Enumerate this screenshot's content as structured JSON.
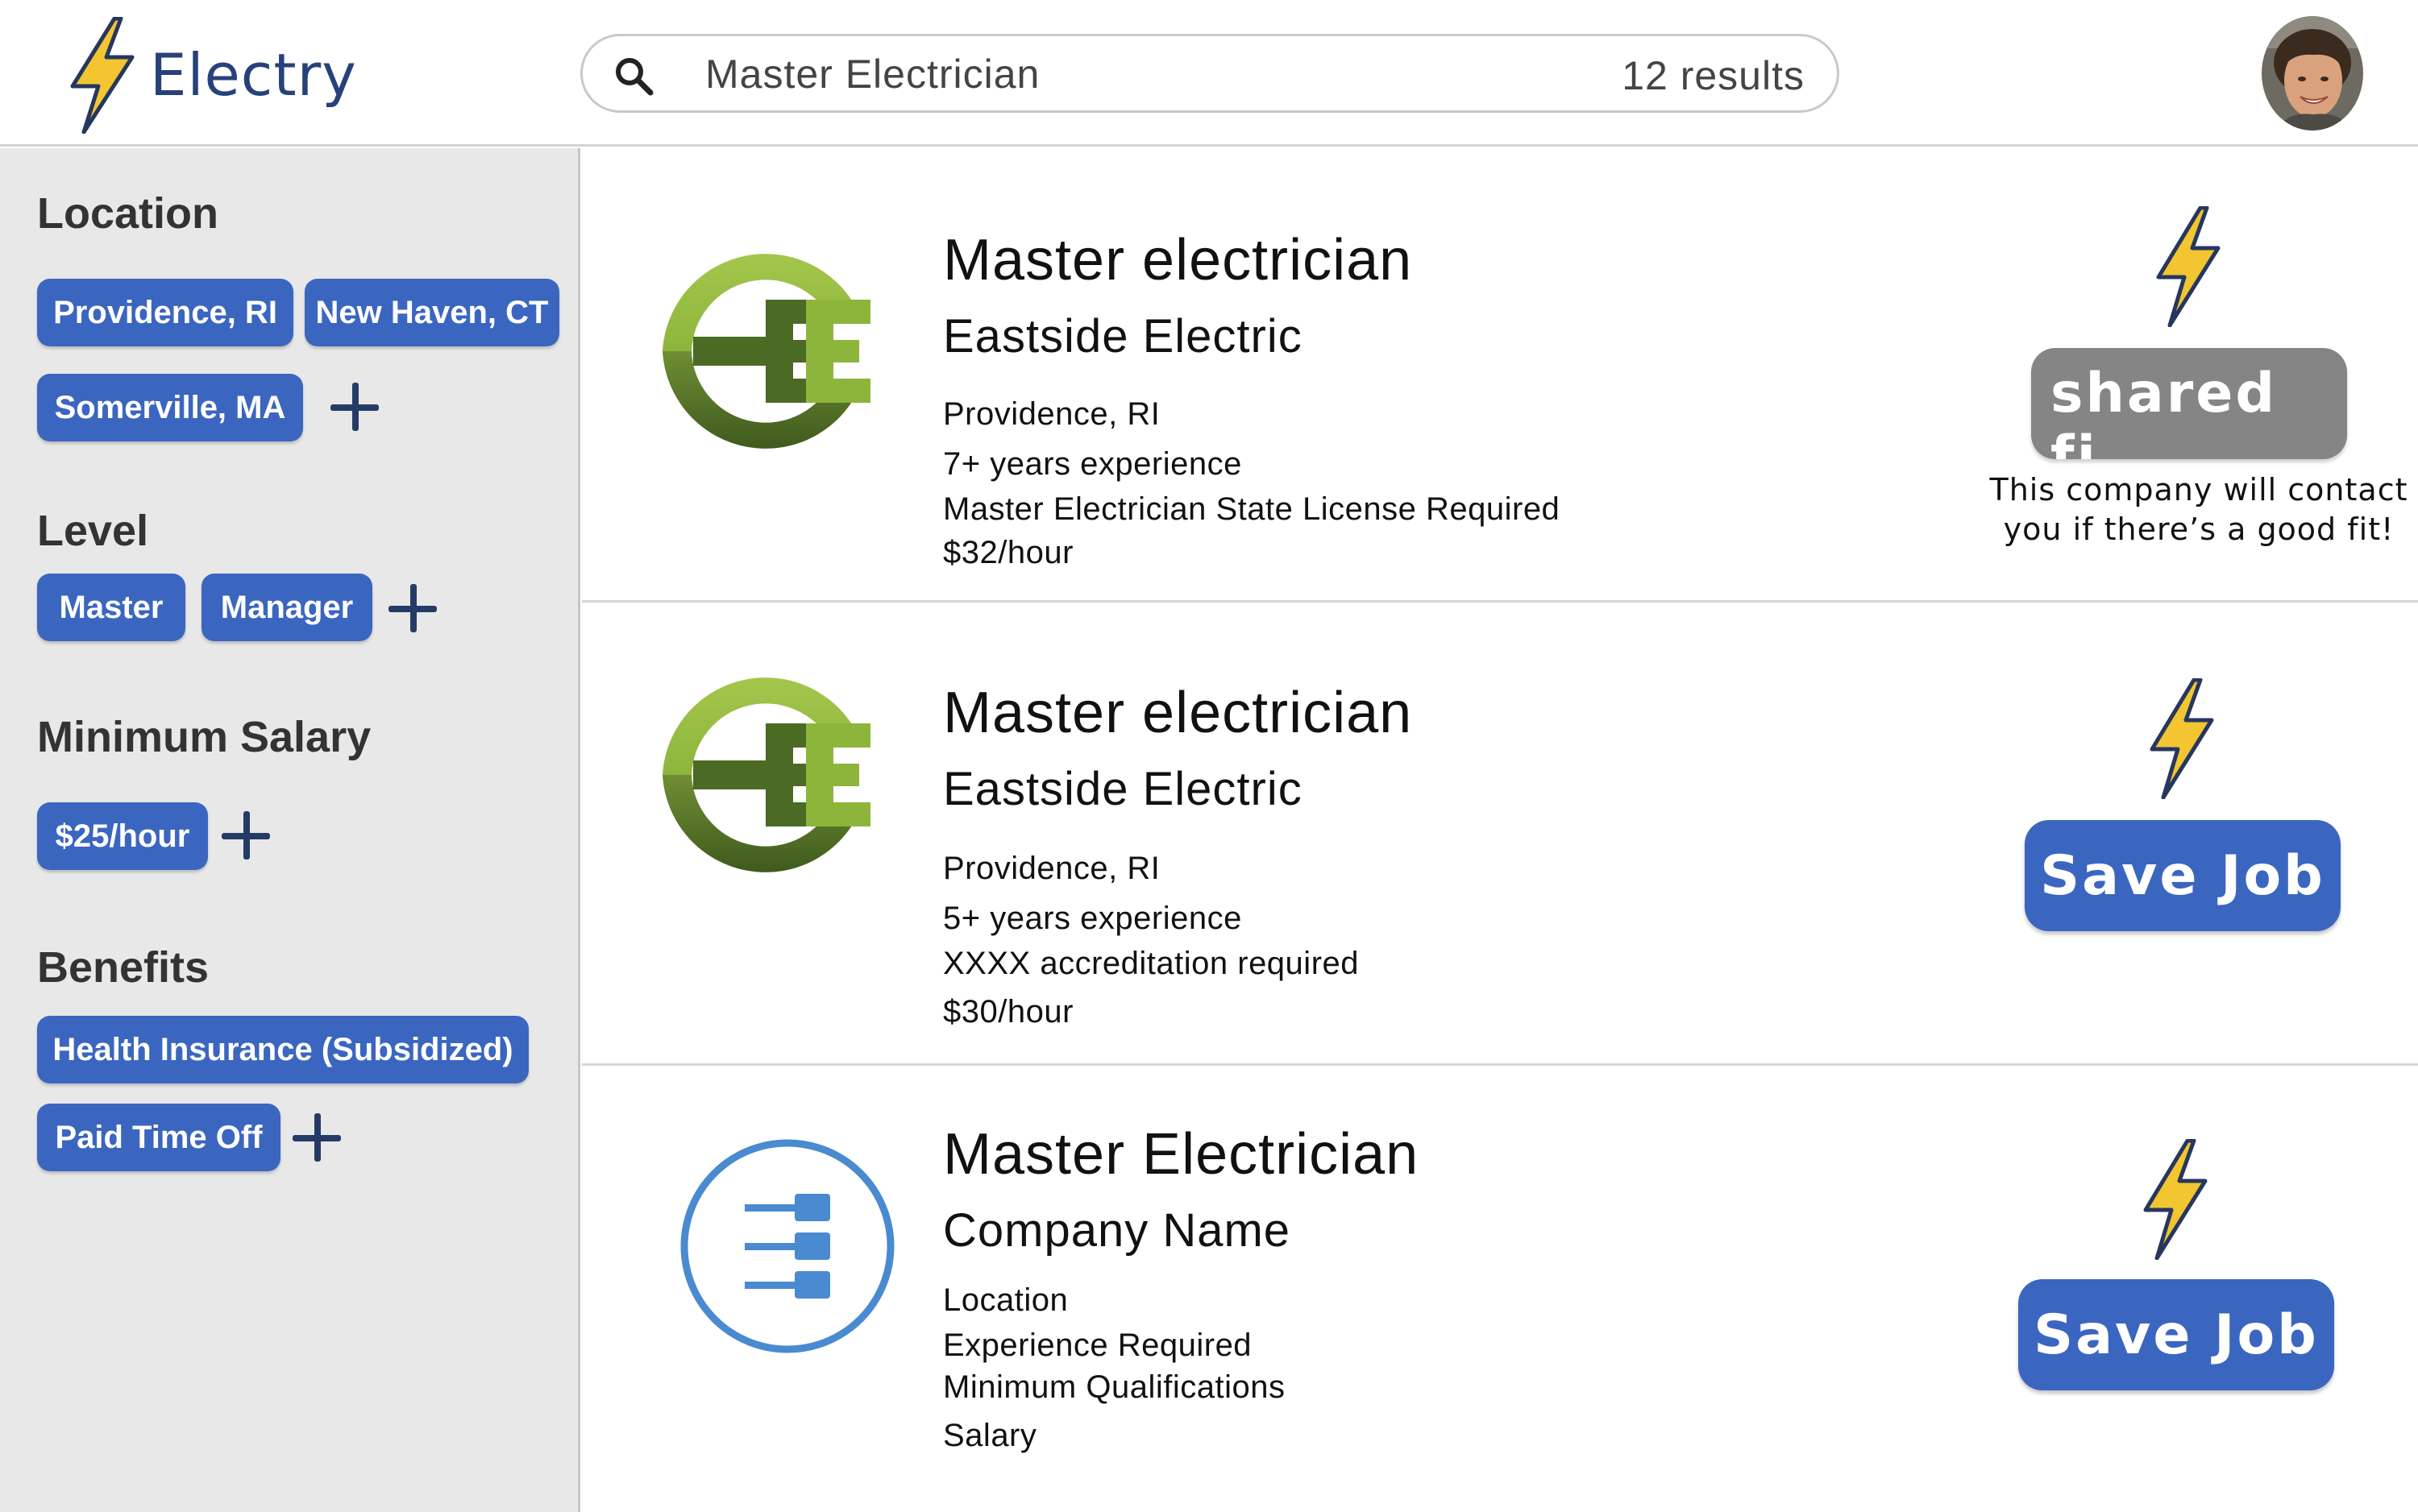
{
  "app": {
    "name": "Electry"
  },
  "search": {
    "value": "Master Electrician",
    "result_count": "12 results"
  },
  "filters": {
    "location": {
      "title": "Location",
      "chips": [
        "Providence, RI",
        "New Haven, CT",
        "Somerville, MA"
      ]
    },
    "level": {
      "title": "Level",
      "chips": [
        "Master",
        "Manager"
      ]
    },
    "salary": {
      "title": "Minimum Salary",
      "chips": [
        "$25/hour"
      ]
    },
    "benefits": {
      "title": "Benefits",
      "chips": [
        "Health Insurance (Subsidized)",
        "Paid Time Off"
      ]
    }
  },
  "results": [
    {
      "title": "Master electrician",
      "company": "Eastside Electric",
      "location": "Providence, RI",
      "experience": "7+ years experience",
      "requirement": "Master Electrician State License Required",
      "pay": "$32/hour",
      "action_label": "shared fi",
      "note": [
        "This company will contact",
        "you if there’s a good fit!"
      ]
    },
    {
      "title": "Master electrician",
      "company": "Eastside Electric",
      "location": "Providence, RI",
      "experience": "5+ years experience",
      "requirement": "XXXX accreditation required",
      "pay": "$30/hour",
      "action_label": "Save Job"
    },
    {
      "title": "Master Electrician",
      "company": "Company Name",
      "location": "Location",
      "experience": "Experience Required",
      "requirement": "Minimum Qualifications",
      "pay": "Salary",
      "action_label": "Save Job"
    }
  ],
  "colors": {
    "brand_navy": "#27427a",
    "chip_blue": "#3b66c0",
    "bolt_yellow": "#f2c531",
    "eastside_green_light": "#8db53c",
    "eastside_green_dark": "#4b6a24",
    "placeholder_logo_blue": "#4a8ad0",
    "shared_gray": "#858585"
  },
  "icons": [
    "lightning-bolt-icon",
    "search-icon",
    "plus-icon",
    "user-avatar"
  ]
}
